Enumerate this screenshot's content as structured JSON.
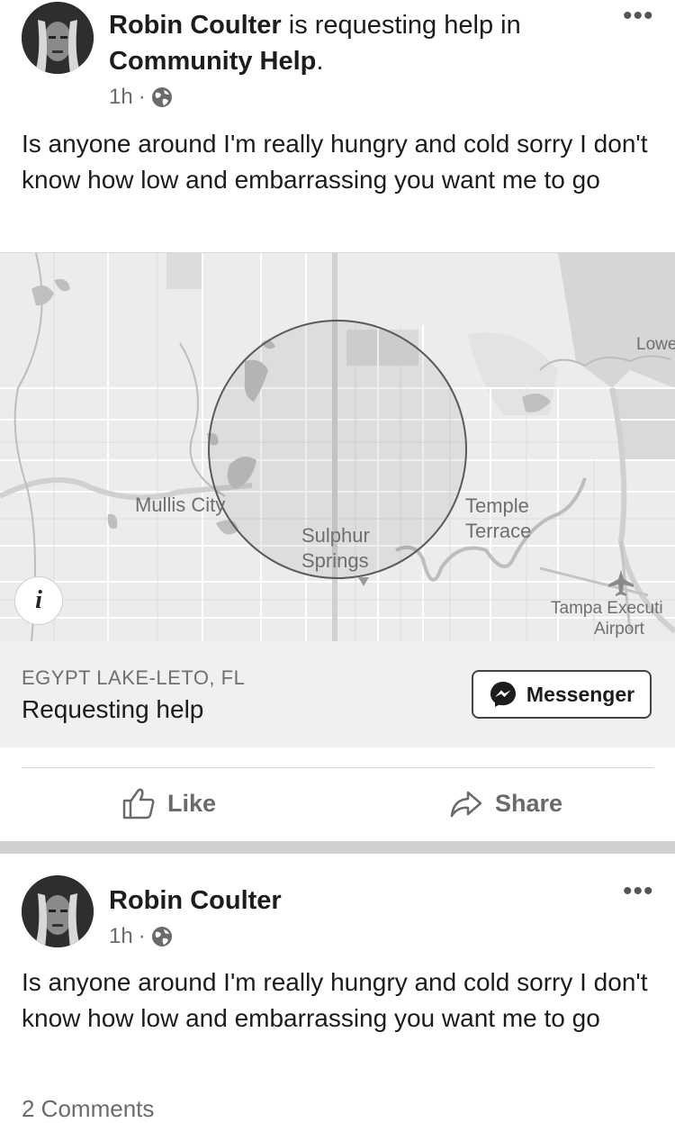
{
  "post1": {
    "author": "Robin Coulter",
    "action_text": " is requesting help in",
    "group": "Community Help",
    "group_suffix": ".",
    "time": "1h",
    "dot": "·",
    "body": "Is anyone around I'm really hungry and cold sorry I don't know how low and embarrassing you want me to go",
    "more_label": "•••"
  },
  "map": {
    "labels": {
      "mullis_city": "Mullis City",
      "sulphur": "Sulphur",
      "springs": "Springs",
      "temple": "Temple",
      "terrace": "Terrace",
      "tampa_exec": "Tampa Executi",
      "airport": "Airport",
      "lowe": "Lowe"
    },
    "info_label": "i"
  },
  "location": {
    "area": "EGYPT LAKE-LETO, FL",
    "status": "Requesting help",
    "messenger_label": "Messenger"
  },
  "actions": {
    "like": "Like",
    "share": "Share"
  },
  "post2": {
    "author": "Robin Coulter",
    "time": "1h",
    "dot": "·",
    "body": "Is anyone around I'm really hungry and cold sorry I don't know how low and embarrassing you want me to go",
    "comments": "2 Comments",
    "more_label": "•••"
  },
  "colors": {
    "text": "#1c1c1c",
    "muted": "#6b6b6b",
    "map_bg": "#ededed",
    "panel_bg": "#f0f0f0",
    "separator": "#cfcfcf"
  },
  "icons": {
    "privacy": "globe-icon",
    "more": "more-options-icon",
    "like": "thumbs-up-icon",
    "share": "share-arrow-icon",
    "messenger": "messenger-icon",
    "airport": "airplane-icon",
    "info": "info-icon"
  }
}
